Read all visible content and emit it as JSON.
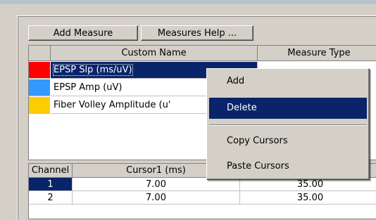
{
  "toolbar": {
    "add_measure_label": "Add Measure",
    "measures_help_label": "Measures Help ..."
  },
  "measures_table": {
    "columns": [
      "Custom Name",
      "Measure Type"
    ],
    "rows": [
      {
        "color": "#ff0000",
        "name": "EPSP Slp (ms/uV)",
        "selected": true
      },
      {
        "color": "#3399ff",
        "name": "EPSP Amp (uV)",
        "selected": false
      },
      {
        "color": "#ffcc00",
        "name": "Fiber Volley Amplitude (u'",
        "selected": false
      }
    ]
  },
  "cursor_table": {
    "columns": [
      "Channel",
      "Cursor1 (ms)",
      ""
    ],
    "rows": [
      {
        "channel": "1",
        "cursor1": "7.00",
        "cursor2": "35.00",
        "selected": true
      },
      {
        "channel": "2",
        "cursor1": "7.00",
        "cursor2": "35.00",
        "selected": false
      }
    ]
  },
  "context_menu": {
    "items": [
      "Add",
      "Delete",
      "Copy Cursors",
      "Paste Cursors"
    ],
    "active_index": 1
  },
  "colors": {
    "selection": "#0a246a",
    "window_bg": "#d4d0c8"
  }
}
